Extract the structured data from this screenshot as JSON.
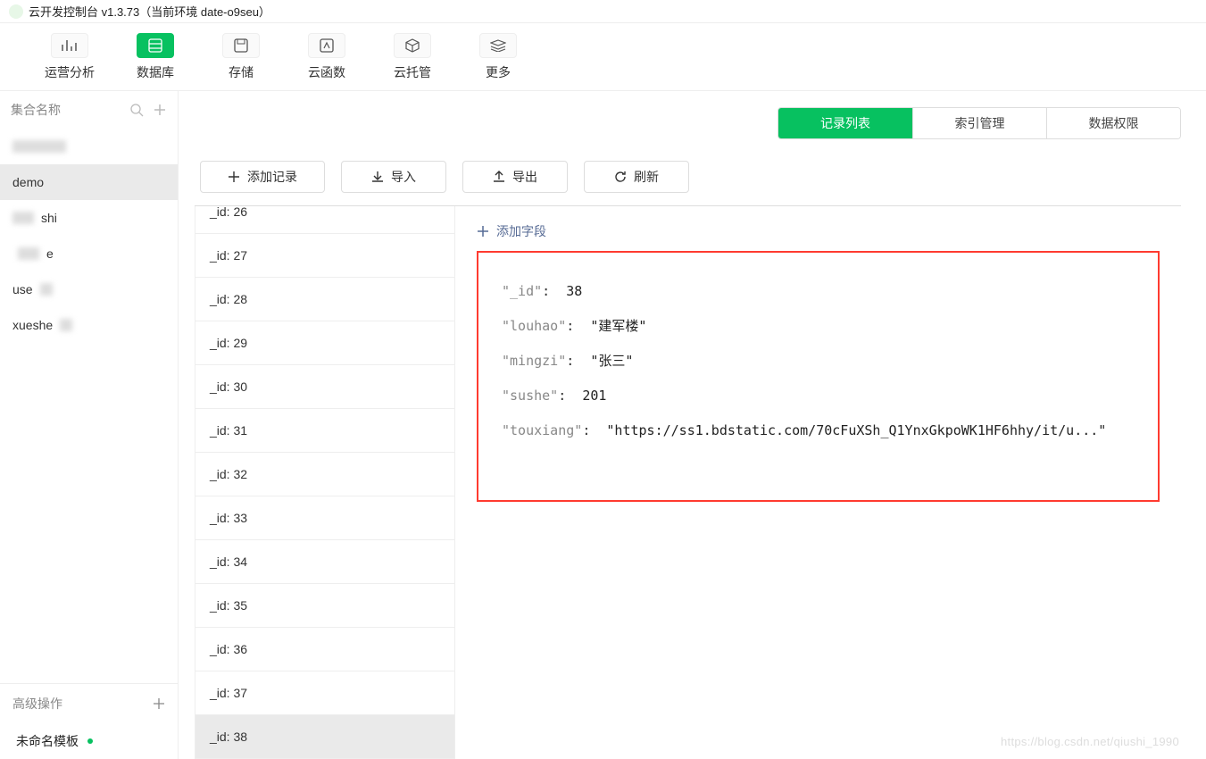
{
  "window": {
    "title": "云开发控制台 v1.3.73（当前环境 date-o9seu）"
  },
  "toolbar": {
    "items": [
      {
        "label": "运营分析",
        "icon": "chart-icon"
      },
      {
        "label": "数据库",
        "icon": "database-icon"
      },
      {
        "label": "存储",
        "icon": "save-icon"
      },
      {
        "label": "云函数",
        "icon": "function-icon"
      },
      {
        "label": "云托管",
        "icon": "cube-icon"
      },
      {
        "label": "更多",
        "icon": "layers-icon"
      }
    ]
  },
  "sidebar": {
    "head_label": "集合名称",
    "collections": [
      {
        "label": ""
      },
      {
        "label": "demo"
      },
      {
        "label": "shi"
      },
      {
        "label": "e"
      },
      {
        "label": "use"
      },
      {
        "label": "xueshe"
      }
    ],
    "advanced_label": "高级操作",
    "template_label": "未命名模板"
  },
  "tabs": {
    "items": [
      "记录列表",
      "索引管理",
      "数据权限"
    ]
  },
  "actions": {
    "add": "添加记录",
    "import": "导入",
    "export": "导出",
    "refresh": "刷新"
  },
  "id_list_prefix": "_id: ",
  "id_list": [
    "26",
    "27",
    "28",
    "29",
    "30",
    "31",
    "32",
    "33",
    "34",
    "35",
    "36",
    "37",
    "38"
  ],
  "add_field_label": "添加字段",
  "document": {
    "_id": 38,
    "louhao": "建军楼",
    "mingzi": "张三",
    "sushe": 201,
    "touxiang": "https://ss1.bdstatic.com/70cFuXSh_Q1YnxGkpoWK1HF6hhy/it/u..."
  },
  "watermark": "https://blog.csdn.net/qiushi_1990"
}
